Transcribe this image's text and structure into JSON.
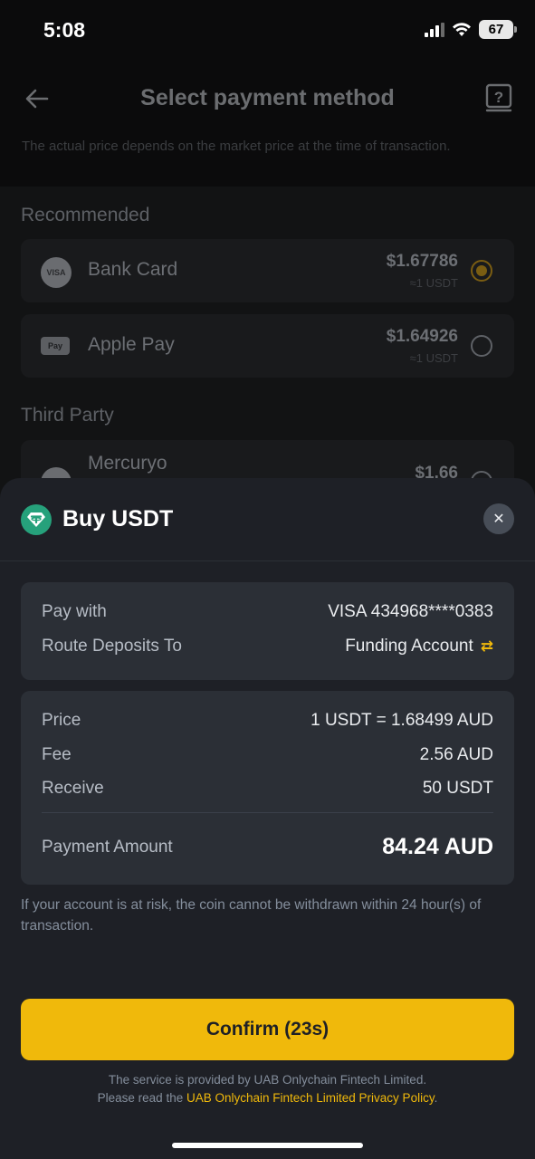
{
  "status_bar": {
    "time": "5:08",
    "battery": "67"
  },
  "header": {
    "title": "Select payment method"
  },
  "notice": "The actual price depends on the market price at the time of transaction.",
  "recommended": {
    "title": "Recommended",
    "methods": [
      {
        "label": "Bank Card",
        "price": "$1.67786",
        "sub": "≈1 USDT",
        "icon_text": "VISA",
        "selected": true
      },
      {
        "label": "Apple Pay",
        "price": "$1.64926",
        "sub": "≈1 USDT",
        "icon_text": "Pay",
        "selected": false
      }
    ]
  },
  "third_party": {
    "title": "Third Party",
    "methods": [
      {
        "label": "Mercuryo",
        "price": "$1.66",
        "selected": false
      }
    ]
  },
  "sheet": {
    "title": "Buy USDT",
    "pay_with": {
      "label": "Pay with",
      "value": "VISA 434968****0383"
    },
    "route": {
      "label": "Route Deposits To",
      "value": "Funding Account"
    },
    "price": {
      "label": "Price",
      "value": "1 USDT = 1.68499 AUD"
    },
    "fee": {
      "label": "Fee",
      "value": "2.56 AUD"
    },
    "receive": {
      "label": "Receive",
      "value": "50 USDT"
    },
    "payment_amount": {
      "label": "Payment Amount",
      "value": "84.24 AUD"
    },
    "risk_note": "If your account is at risk, the coin cannot be withdrawn within 24 hour(s) of transaction.",
    "confirm_label": "Confirm (23s)",
    "footer_line1": "The service is provided by UAB Onlychain Fintech Limited.",
    "footer_prefix": "Please read the",
    "footer_link": "UAB Onlychain Fintech Limited Privacy Policy",
    "footer_suffix": "."
  },
  "colors": {
    "accent": "#f0b90b",
    "tether": "#26a17b",
    "sheet_bg": "#1e2026",
    "card_bg": "#2b2f36"
  }
}
